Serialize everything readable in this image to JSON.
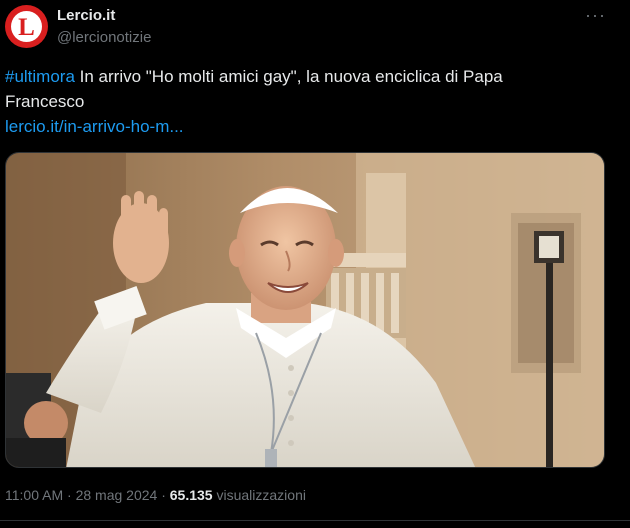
{
  "author": {
    "name": "Lercio.it",
    "handle": "@lercionotizie",
    "avatar_letter": "L",
    "avatar_color": "#d91f1f"
  },
  "more_glyph": "···",
  "post": {
    "hashtag": "#ultimora",
    "text_line1": " In arrivo \"Ho molti amici gay\", la nuova enciclica di Papa",
    "text_line2": "Francesco",
    "link": "lercio.it/in-arrivo-ho-m..."
  },
  "media": {
    "icon": "photo-of-pope-waving"
  },
  "meta": {
    "time": "11:00 AM",
    "separator": " · ",
    "date": "28 mag 2024",
    "separator2": " · ",
    "views_count": "65.135",
    "views_label": " visualizzazioni"
  },
  "colors": {
    "background": "#000000",
    "text": "#e7e9ea",
    "secondary": "#71767b",
    "link": "#1d9bf0"
  }
}
